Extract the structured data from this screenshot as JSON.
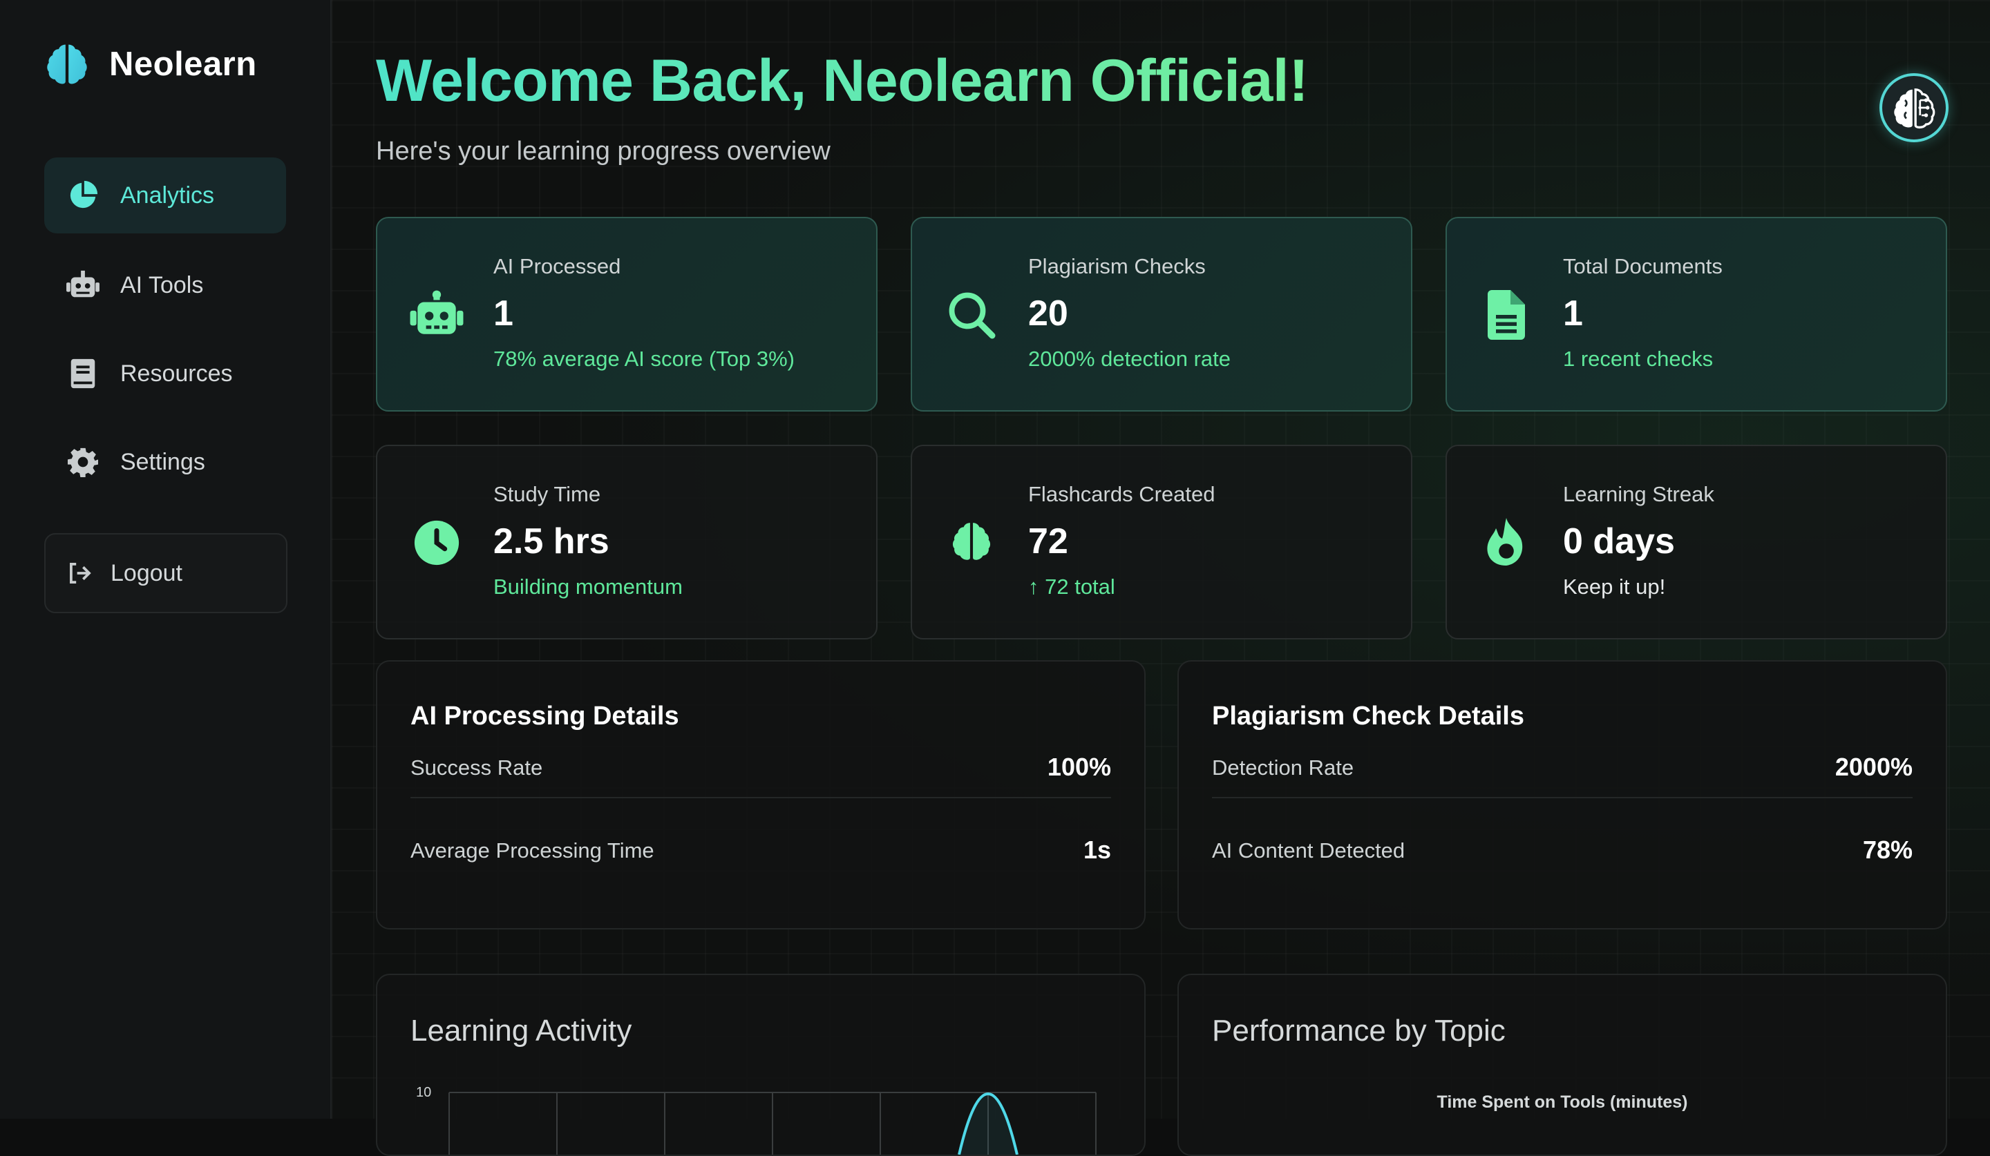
{
  "brand": {
    "name": "Neolearn"
  },
  "sidebar": {
    "items": [
      {
        "label": "Analytics",
        "icon": "pie-chart-icon",
        "active": true
      },
      {
        "label": "AI Tools",
        "icon": "robot-icon",
        "active": false
      },
      {
        "label": "Resources",
        "icon": "book-icon",
        "active": false
      },
      {
        "label": "Settings",
        "icon": "gear-icon",
        "active": false
      }
    ],
    "logout_label": "Logout"
  },
  "header": {
    "title": "Welcome Back, Neolearn Official!",
    "subtitle": "Here's your learning progress overview"
  },
  "stats": [
    {
      "label": "AI Processed",
      "value": "1",
      "sub": "78% average AI score (Top 3%)",
      "icon": "robot-icon"
    },
    {
      "label": "Plagiarism Checks",
      "value": "20",
      "sub": "2000% detection rate",
      "icon": "search-icon"
    },
    {
      "label": "Total Documents",
      "value": "1",
      "sub": "1 recent checks",
      "icon": "document-icon"
    },
    {
      "label": "Study Time",
      "value": "2.5 hrs",
      "sub": "Building momentum",
      "icon": "clock-icon"
    },
    {
      "label": "Flashcards Created",
      "value": "72",
      "sub": "↑ 72 total",
      "icon": "brain-icon"
    },
    {
      "label": "Learning Streak",
      "value": "0 days",
      "sub": "Keep it up!",
      "icon": "fire-icon"
    }
  ],
  "ai_details": {
    "title": "AI Processing Details",
    "rows": [
      {
        "label": "Success Rate",
        "value": "100%"
      },
      {
        "label": "Average Processing Time",
        "value": "1s"
      }
    ]
  },
  "plag_details": {
    "title": "Plagiarism Check Details",
    "rows": [
      {
        "label": "Detection Rate",
        "value": "2000%"
      },
      {
        "label": "AI Content Detected",
        "value": "78%"
      }
    ]
  },
  "learning_activity": {
    "title": "Learning Activity",
    "y_tick_top": "10"
  },
  "performance": {
    "title": "Performance by Topic",
    "chart_title": "Time Spent on Tools (minutes)"
  },
  "colors": {
    "accent_teal": "#5de8d8",
    "accent_green": "#5fe89b",
    "icon_green": "#6ef0a6"
  }
}
